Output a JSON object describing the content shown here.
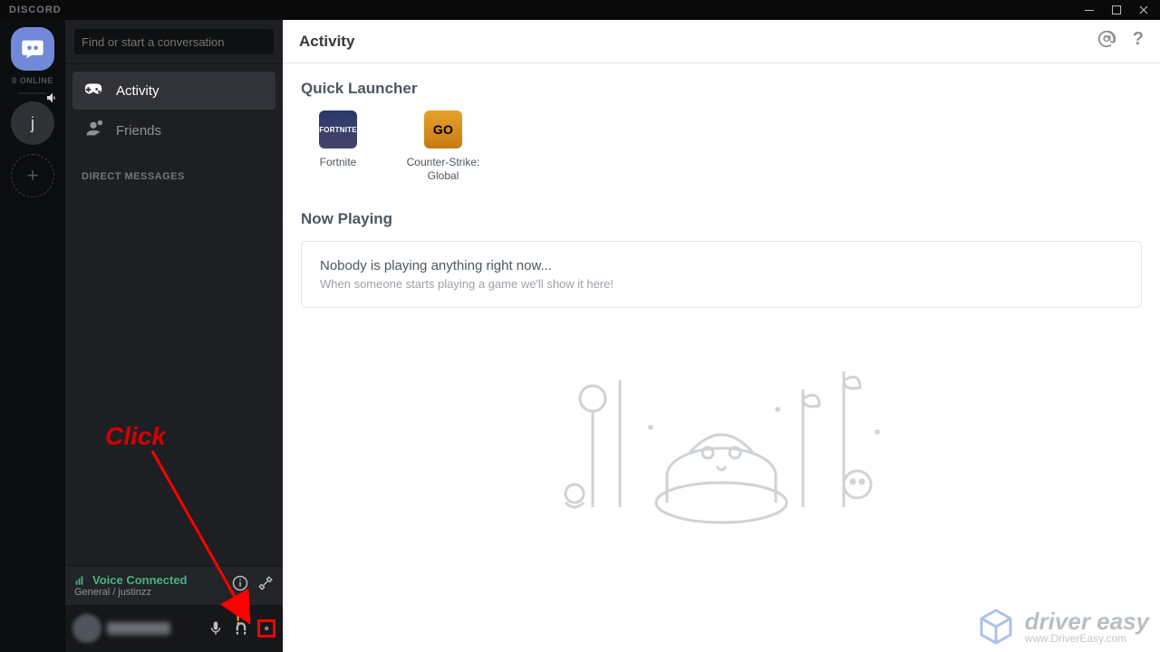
{
  "titlebar": {
    "appname": "DISCORD"
  },
  "guild_rail": {
    "online_label": "0 ONLINE",
    "server_initial": "j"
  },
  "dm_col": {
    "search_placeholder": "Find or start a conversation",
    "tabs": {
      "activity": "Activity",
      "friends": "Friends"
    },
    "dm_header": "DIRECT MESSAGES"
  },
  "voice_panel": {
    "status": "Voice Connected",
    "channel": "General / justinzz"
  },
  "main": {
    "header": "Activity",
    "quick_launcher_title": "Quick Launcher",
    "games": [
      {
        "label": "Fortnite",
        "icon_text": "FORTNITE",
        "class": "game-fortnite"
      },
      {
        "label": "Counter-Strike: Global",
        "icon_text": "GO",
        "class": "game-csgo"
      }
    ],
    "now_playing_title": "Now Playing",
    "empty_title": "Nobody is playing anything right now...",
    "empty_sub": "When someone starts playing a game we'll show it here!"
  },
  "annotation": {
    "click_label": "Click"
  },
  "watermark": {
    "brand": "driver easy",
    "url": "www.DriverEasy.com"
  }
}
